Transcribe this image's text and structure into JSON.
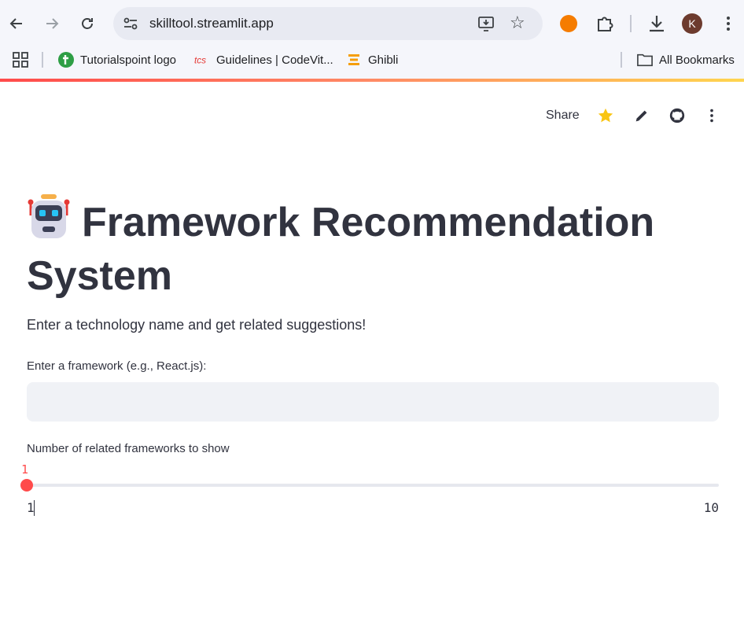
{
  "browser": {
    "url": "skilltool.streamlit.app",
    "profile_initial": "K",
    "bookmarks": [
      {
        "label": "Tutorialspoint logo",
        "icon": "tutorialspoint-icon"
      },
      {
        "label": "Guidelines | CodeVit...",
        "icon": "tcs-icon"
      },
      {
        "label": "Ghibli",
        "icon": "ghibli-icon"
      }
    ],
    "all_bookmarks": "All Bookmarks"
  },
  "header": {
    "share_label": "Share"
  },
  "main": {
    "title": "Framework Recommendation System",
    "subtitle": "Enter a technology name and get related suggestions!",
    "framework_input": {
      "label": "Enter a framework (e.g., React.js):",
      "value": "",
      "placeholder": ""
    },
    "slider": {
      "label": "Number of related frameworks to show",
      "value": "1",
      "min": "1",
      "max": "10",
      "fill_fraction": 0
    }
  },
  "colors": {
    "accent": "#ff4b4b",
    "text": "#31333f",
    "input_bg": "#f0f2f6",
    "star": "#f9c513"
  }
}
